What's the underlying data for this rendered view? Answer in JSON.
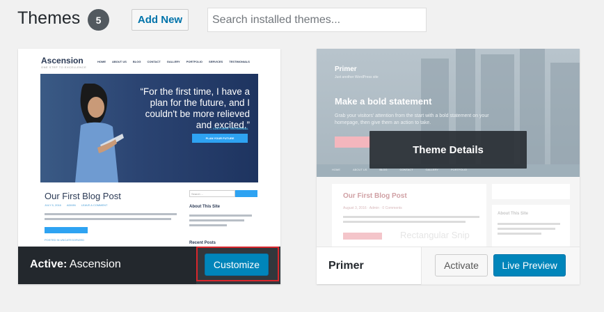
{
  "header": {
    "title": "Themes",
    "count": "5",
    "add_new_label": "Add New",
    "search_placeholder": "Search installed themes..."
  },
  "active_theme": {
    "label_prefix": "Active:",
    "name": "Ascension",
    "customize_label": "Customize",
    "screenshot": {
      "logo": "Ascension",
      "tagline": "ONE STEP TO EXCELLENCE",
      "nav": [
        "HOME",
        "ABOUT US",
        "BLOG",
        "CONTACT",
        "GALLERY",
        "PORTFOLIO",
        "SERVICES",
        "TESTIMONIALS"
      ],
      "hero_quote": "“For the first time, I have a plan for the future, and I couldn't be more relieved and excited.”",
      "hero_link": "— CUSTOMER TESTIMONIAL",
      "hero_button": "PLAN YOUR FUTURE",
      "post_title": "Our First Blog Post",
      "post_meta": [
        "JULY 5, 2016",
        "ADMIN",
        "LEAVE A COMMENT"
      ],
      "post_footer_link": "POSTED IN UNCATEGORIZED",
      "search_placeholder": "Search ...",
      "sidebar_about": "About This Site",
      "sidebar_recent": "Recent Posts"
    }
  },
  "other_theme": {
    "name": "Primer",
    "details_label": "Theme Details",
    "activate_label": "Activate",
    "live_preview_label": "Live Preview",
    "screenshot": {
      "site_title": "Primer",
      "tagline": "Just another WordPress site",
      "headline": "Make a bold statement",
      "subtext": "Grab your visitors' attention from the start with a bold statement on your homepage, then give them an action to take.",
      "nav": [
        "HOME",
        "ABOUT US",
        "BLOG",
        "CONTACT",
        "GALLERY",
        "PORTFOLIO"
      ],
      "post_title": "Our First Blog Post",
      "post_meta": "August 3, 2016   ·   Admin   ·   0 Comments",
      "sidebar_about": "About This Site",
      "ghost_text": "Rectangular Snip"
    }
  },
  "colors": {
    "accent": "#0085ba",
    "highlight_border": "#d9262c",
    "active_footer": "#23282d"
  }
}
